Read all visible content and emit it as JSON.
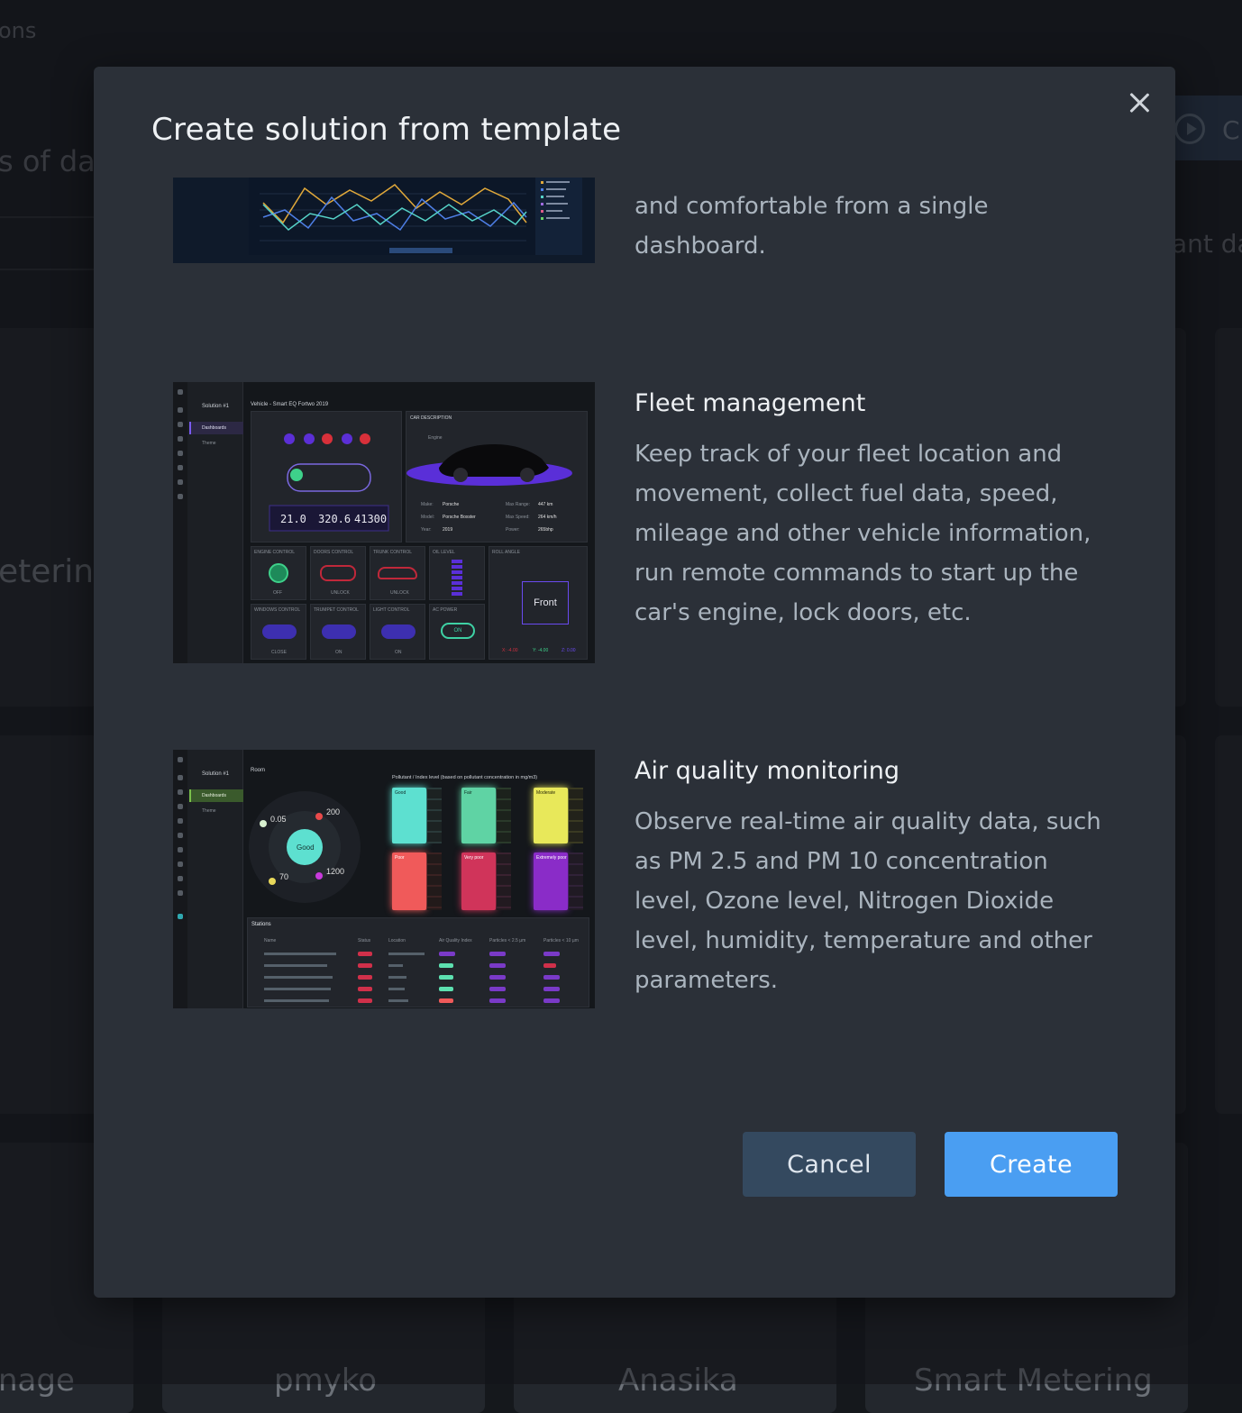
{
  "background": {
    "top_left_text": "ons",
    "subtitle_fragment": "s of das",
    "side_text_right": "ant da",
    "card_left_title": "etering",
    "pill_text": "Cr",
    "bottom_cards": [
      "nage",
      "pmyko",
      "Anasika",
      "Smart Metering"
    ]
  },
  "modal": {
    "title": "Create solution from template",
    "close_icon": "close-icon",
    "templates": [
      {
        "title": "",
        "description_visible": "and comfortable from a single dashboard."
      },
      {
        "title": "Fleet management",
        "description": "Keep track of your fleet location and movement, collect fuel data, speed, mileage and other vehicle information, run remote commands to start up the car's engine, lock doors, etc."
      },
      {
        "title": "Air quality monitoring",
        "description": "Observe real-time air quality data, such as PM 2.5 and PM 10 concentration level, Ozone level, Nitrogen Dioxide level, humidity, temperature and other parameters."
      }
    ],
    "buttons": {
      "cancel": "Cancel",
      "create": "Create"
    }
  },
  "fleet_preview": {
    "vehicle_title": "Vehicle - Smart EQ Fortwo 2019",
    "car_description": "CAR DESCRIPTION",
    "engine_label": "Engine",
    "readouts": [
      "21.0",
      "320.6",
      "41300"
    ],
    "specs": [
      [
        "Make:",
        "Porsche",
        "Max Range:",
        "447 km"
      ],
      [
        "Model:",
        "Porsche Boxster",
        "Max Speed:",
        "264 km/h"
      ],
      [
        "Year:",
        "2019",
        "Power:",
        "265bhp"
      ]
    ],
    "controls": [
      "ENGINE CONTROL",
      "DOORS CONTROL",
      "TRUNK CONTROL",
      "OIL LEVEL",
      "ROLL ANGLE",
      "WINDOWS CONTROL",
      "TRUMPET CONTROL",
      "LIGHT CONTROL",
      "AC POWER"
    ],
    "states": [
      "OFF",
      "UNLOCK",
      "UNLOCK",
      "CLOSE",
      "ON",
      "ON"
    ],
    "ac_state": "ON",
    "front_label": "Front",
    "axes": [
      "X: -4.00",
      "Y: -4.00",
      "Z: 0.00"
    ],
    "solution": "Solution #1",
    "dashboards": "Dashboards",
    "theme": "Theme"
  },
  "air_preview": {
    "room": "Room",
    "pollutant_header": "Pollutant  /  Index level (based on pollutant concentration in mg/m3)",
    "center_label": "Good",
    "readings": [
      "0.05",
      "200",
      "70",
      "1200"
    ],
    "levels": [
      "Good",
      "Fair",
      "Moderate",
      "Poor",
      "Very poor",
      "Extremely poor"
    ],
    "stations_title": "Stations",
    "table_headers": [
      "Name",
      "Status",
      "Location",
      "Air Quality Index",
      "Particles < 2.5 µm",
      "Particles < 10 µm"
    ],
    "colors": {
      "good": "#5de0d0",
      "fair": "#5fd3a4",
      "moderate": "#e8e85a",
      "poor": "#f05a5a",
      "very_poor": "#d0345a",
      "extremely_poor": "#8a2cc8"
    }
  },
  "colors": {
    "accent": "#4a9ef2",
    "cancel_bg": "#34495f",
    "modal_bg": "#2b3038"
  }
}
